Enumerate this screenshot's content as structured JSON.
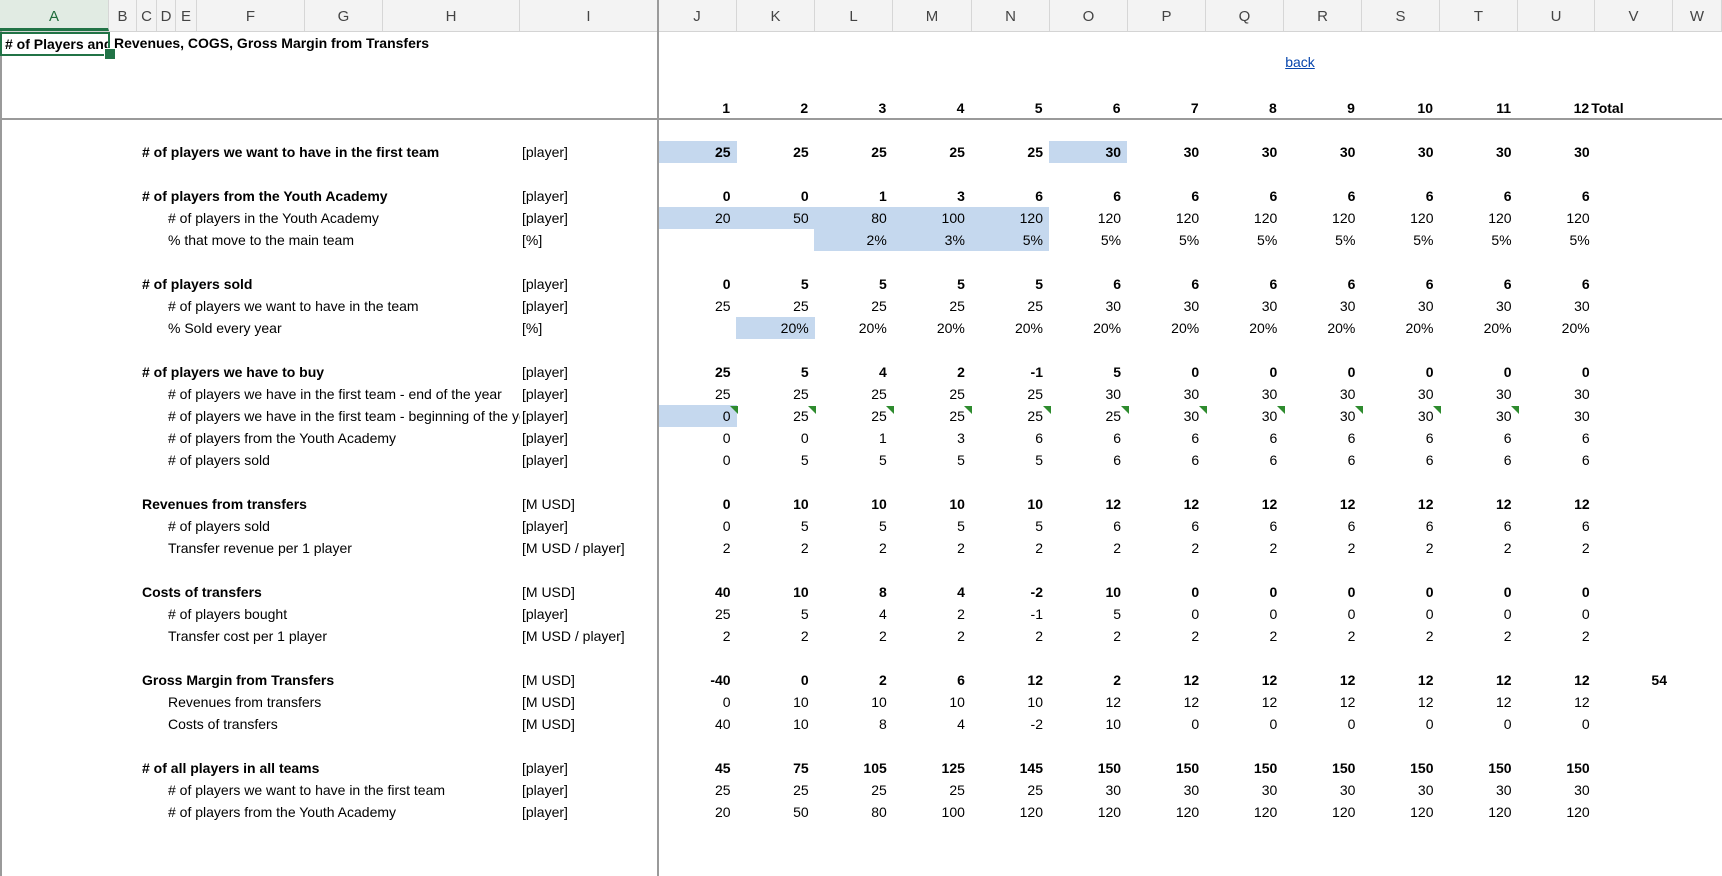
{
  "column_headers": [
    "A",
    "B",
    "C",
    "D",
    "E",
    "F",
    "G",
    "H",
    "I",
    "J",
    "K",
    "L",
    "M",
    "N",
    "O",
    "P",
    "Q",
    "R",
    "S",
    "T",
    "U",
    "V",
    "W"
  ],
  "active_column": "A",
  "title_cell": "# of Players and Revenues, COGS, Gross Margin from Transfers",
  "back_link": "back",
  "period_headers": [
    "1",
    "2",
    "3",
    "4",
    "5",
    "6",
    "7",
    "8",
    "9",
    "10",
    "11",
    "12"
  ],
  "total_header": "Total",
  "highlight_color": "#c5d8ee",
  "rows": [
    {
      "label": "# of players we want to have in the first team",
      "unit": "[player]",
      "bold": true,
      "indent": false,
      "values": [
        "25",
        "25",
        "25",
        "25",
        "25",
        "30",
        "30",
        "30",
        "30",
        "30",
        "30",
        "30"
      ],
      "highlight": [
        0,
        5
      ]
    },
    {
      "label": "# of players from the Youth Academy",
      "unit": "[player]",
      "bold": true,
      "indent": false,
      "values": [
        "0",
        "0",
        "1",
        "3",
        "6",
        "6",
        "6",
        "6",
        "6",
        "6",
        "6",
        "6"
      ]
    },
    {
      "label": "# of players in the Youth Academy",
      "unit": "[player]",
      "bold": false,
      "indent": true,
      "values": [
        "20",
        "50",
        "80",
        "100",
        "120",
        "120",
        "120",
        "120",
        "120",
        "120",
        "120",
        "120"
      ],
      "highlight": [
        0,
        1,
        2,
        3,
        4
      ]
    },
    {
      "label": "% that move to the main team",
      "unit": "[%]",
      "bold": false,
      "indent": true,
      "values": [
        "",
        "",
        "2%",
        "3%",
        "5%",
        "5%",
        "5%",
        "5%",
        "5%",
        "5%",
        "5%",
        "5%"
      ],
      "highlight": [
        2,
        3,
        4
      ]
    },
    {
      "label": "# of players sold",
      "unit": "[player]",
      "bold": true,
      "indent": false,
      "values": [
        "0",
        "5",
        "5",
        "5",
        "5",
        "6",
        "6",
        "6",
        "6",
        "6",
        "6",
        "6"
      ]
    },
    {
      "label": "# of players we want to have in the team",
      "unit": "[player]",
      "bold": false,
      "indent": true,
      "values": [
        "25",
        "25",
        "25",
        "25",
        "25",
        "30",
        "30",
        "30",
        "30",
        "30",
        "30",
        "30"
      ]
    },
    {
      "label": "% Sold every year",
      "unit": "[%]",
      "bold": false,
      "indent": true,
      "values": [
        "",
        "20%",
        "20%",
        "20%",
        "20%",
        "20%",
        "20%",
        "20%",
        "20%",
        "20%",
        "20%",
        "20%"
      ],
      "highlight": [
        1
      ]
    },
    {
      "label": "# of players we have to buy",
      "unit": "[player]",
      "bold": true,
      "indent": false,
      "values": [
        "25",
        "5",
        "4",
        "2",
        "-1",
        "5",
        "0",
        "0",
        "0",
        "0",
        "0",
        "0"
      ]
    },
    {
      "label": "# of players we have in the first team - end of the year",
      "unit": "[player]",
      "bold": false,
      "indent": true,
      "values": [
        "25",
        "25",
        "25",
        "25",
        "25",
        "30",
        "30",
        "30",
        "30",
        "30",
        "30",
        "30"
      ]
    },
    {
      "label": "# of players we have in the first team - beginning of the year",
      "unit": "[player]",
      "bold": false,
      "indent": true,
      "values": [
        "0",
        "25",
        "25",
        "25",
        "25",
        "25",
        "30",
        "30",
        "30",
        "30",
        "30",
        "30"
      ],
      "highlight": [
        0
      ],
      "comments": [
        0,
        1,
        2,
        3,
        4,
        5,
        6,
        7,
        8,
        9,
        10
      ]
    },
    {
      "label": "# of players from the Youth Academy",
      "unit": "[player]",
      "bold": false,
      "indent": true,
      "values": [
        "0",
        "0",
        "1",
        "3",
        "6",
        "6",
        "6",
        "6",
        "6",
        "6",
        "6",
        "6"
      ]
    },
    {
      "label": "# of players sold",
      "unit": "[player]",
      "bold": false,
      "indent": true,
      "values": [
        "0",
        "5",
        "5",
        "5",
        "5",
        "6",
        "6",
        "6",
        "6",
        "6",
        "6",
        "6"
      ]
    },
    {
      "label": "Revenues from transfers",
      "unit": "[M USD]",
      "bold": true,
      "indent": false,
      "values": [
        "0",
        "10",
        "10",
        "10",
        "10",
        "12",
        "12",
        "12",
        "12",
        "12",
        "12",
        "12"
      ]
    },
    {
      "label": "# of players sold",
      "unit": "[player]",
      "bold": false,
      "indent": true,
      "values": [
        "0",
        "5",
        "5",
        "5",
        "5",
        "6",
        "6",
        "6",
        "6",
        "6",
        "6",
        "6"
      ]
    },
    {
      "label": "Transfer revenue per 1 player",
      "unit": "[M USD / player]",
      "bold": false,
      "indent": true,
      "values": [
        "2",
        "2",
        "2",
        "2",
        "2",
        "2",
        "2",
        "2",
        "2",
        "2",
        "2",
        "2"
      ]
    },
    {
      "label": "Costs of transfers",
      "unit": "[M USD]",
      "bold": true,
      "indent": false,
      "values": [
        "40",
        "10",
        "8",
        "4",
        "-2",
        "10",
        "0",
        "0",
        "0",
        "0",
        "0",
        "0"
      ]
    },
    {
      "label": "# of players bought",
      "unit": "[player]",
      "bold": false,
      "indent": true,
      "values": [
        "25",
        "5",
        "4",
        "2",
        "-1",
        "5",
        "0",
        "0",
        "0",
        "0",
        "0",
        "0"
      ]
    },
    {
      "label": "Transfer cost per 1 player",
      "unit": "[M USD / player]",
      "bold": false,
      "indent": true,
      "values": [
        "2",
        "2",
        "2",
        "2",
        "2",
        "2",
        "2",
        "2",
        "2",
        "2",
        "2",
        "2"
      ]
    },
    {
      "label": "Gross Margin from Transfers",
      "unit": "[M USD]",
      "bold": true,
      "indent": false,
      "values": [
        "-40",
        "0",
        "2",
        "6",
        "12",
        "2",
        "12",
        "12",
        "12",
        "12",
        "12",
        "12"
      ],
      "total": "54"
    },
    {
      "label": "Revenues from transfers",
      "unit": "[M USD]",
      "bold": false,
      "indent": true,
      "values": [
        "0",
        "10",
        "10",
        "10",
        "10",
        "12",
        "12",
        "12",
        "12",
        "12",
        "12",
        "12"
      ]
    },
    {
      "label": "Costs of transfers",
      "unit": "[M USD]",
      "bold": false,
      "indent": true,
      "values": [
        "40",
        "10",
        "8",
        "4",
        "-2",
        "10",
        "0",
        "0",
        "0",
        "0",
        "0",
        "0"
      ]
    },
    {
      "label": "# of all players in all teams",
      "unit": "[player]",
      "bold": true,
      "indent": false,
      "values": [
        "45",
        "75",
        "105",
        "125",
        "145",
        "150",
        "150",
        "150",
        "150",
        "150",
        "150",
        "150"
      ]
    },
    {
      "label": "# of players we want to have in the first team",
      "unit": "[player]",
      "bold": false,
      "indent": true,
      "values": [
        "25",
        "25",
        "25",
        "25",
        "25",
        "30",
        "30",
        "30",
        "30",
        "30",
        "30",
        "30"
      ]
    },
    {
      "label": "# of players from the Youth Academy",
      "unit": "[player]",
      "bold": false,
      "indent": true,
      "values": [
        "20",
        "50",
        "80",
        "100",
        "120",
        "120",
        "120",
        "120",
        "120",
        "120",
        "120",
        "120"
      ]
    }
  ]
}
